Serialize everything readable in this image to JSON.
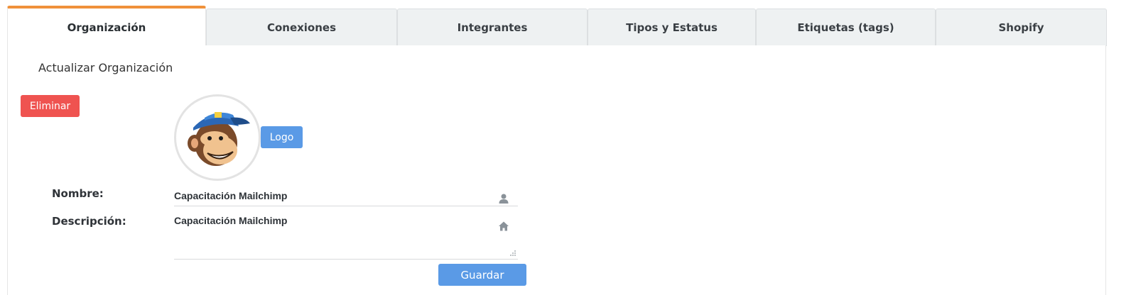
{
  "tabs": [
    {
      "label": "Organización",
      "active": true
    },
    {
      "label": "Conexiones",
      "active": false
    },
    {
      "label": "Integrantes",
      "active": false
    },
    {
      "label": "Tipos y Estatus",
      "active": false
    },
    {
      "label": "Etiquetas (tags)",
      "active": false
    },
    {
      "label": "Shopify",
      "active": false
    }
  ],
  "section": {
    "title": "Actualizar Organización"
  },
  "actions": {
    "delete_label": "Eliminar",
    "logo_label": "Logo",
    "save_label": "Guardar"
  },
  "form": {
    "name_label": "Nombre:",
    "name_value": "Capacitación Mailchimp",
    "description_label": "Descripción:",
    "description_value": "Capacitación Mailchimp"
  },
  "icons": {
    "name_field": "user-icon",
    "description_field": "home-icon",
    "logo_image": "mailchimp-monkey-logo"
  },
  "colors": {
    "active_tab_accent": "#f0913a",
    "danger": "#ef5350",
    "primary": "#5a9ae6"
  }
}
